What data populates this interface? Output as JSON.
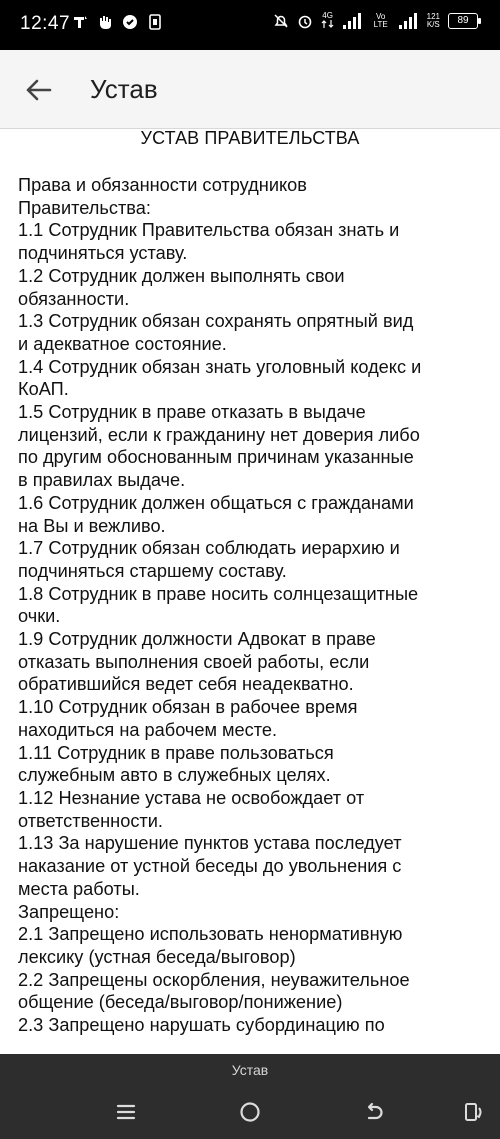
{
  "status_bar": {
    "time": "12:47",
    "network_label": "4G",
    "volte_label": "Vo LTE",
    "speed_value": "121",
    "speed_unit": "K/S",
    "battery": "89"
  },
  "app_bar": {
    "title": "Устав"
  },
  "document": {
    "heading": "УСТАВ ПРАВИТЕЛЬСТВА",
    "lines": [
      "Права и обязанности сотрудников",
      "Правительства:",
      "1.1 Сотрудник Правительства обязан знать и",
      "подчиняться уставу.",
      "1.2 Сотрудник должен выполнять свои",
      "обязанности.",
      "1.3 Сотрудник обязан сохранять опрятный вид",
      "и адекватное состояние.",
      "1.4 Сотрудник обязан знать уголовный кодекс и",
      "КоАП.",
      "1.5 Сотрудник в праве отказать в выдаче",
      "лицензий, если к гражданину нет доверия либо",
      "по другим обоснованным причинам указанные",
      "в правилах выдаче.",
      "1.6 Сотрудник должен общаться с гражданами",
      "на Вы и вежливо.",
      "1.7 Сотрудник обязан соблюдать иерархию и",
      "подчиняться старшему составу.",
      "1.8 Сотрудник в праве носить солнцезащитные",
      "очки.",
      "1.9 Сотрудник должности Адвокат в праве",
      "отказать выполнения своей работы, если",
      "обратившийся ведет себя неадекватно.",
      "1.10 Сотрудник обязан в рабочее время",
      "находиться на рабочем месте.",
      "1.11 Сотрудник в праве пользоваться",
      "служебным авто в служебных целях.",
      "1.12 Незнание устава не освобождает от",
      "ответственности.",
      "1.13 За нарушение пунктов устава последует",
      "наказание от устной беседы до увольнения с",
      "места работы.",
      "Запрещено:",
      "2.1 Запрещено использовать ненормативную",
      "лексику (устная беседа/выговор)",
      "2.2 Запрещены оскорбления, неуважительное",
      "общение (беседа/выговор/понижение)",
      "2.3 Запрещено нарушать субординацию по"
    ]
  },
  "bottom_bar": {
    "label": "Устав"
  },
  "icons": {
    "back": "arrow-left-icon",
    "menu": "menu-icon",
    "home": "home-icon",
    "back_nav": "back-nav-icon",
    "rotate": "rotate-icon"
  }
}
